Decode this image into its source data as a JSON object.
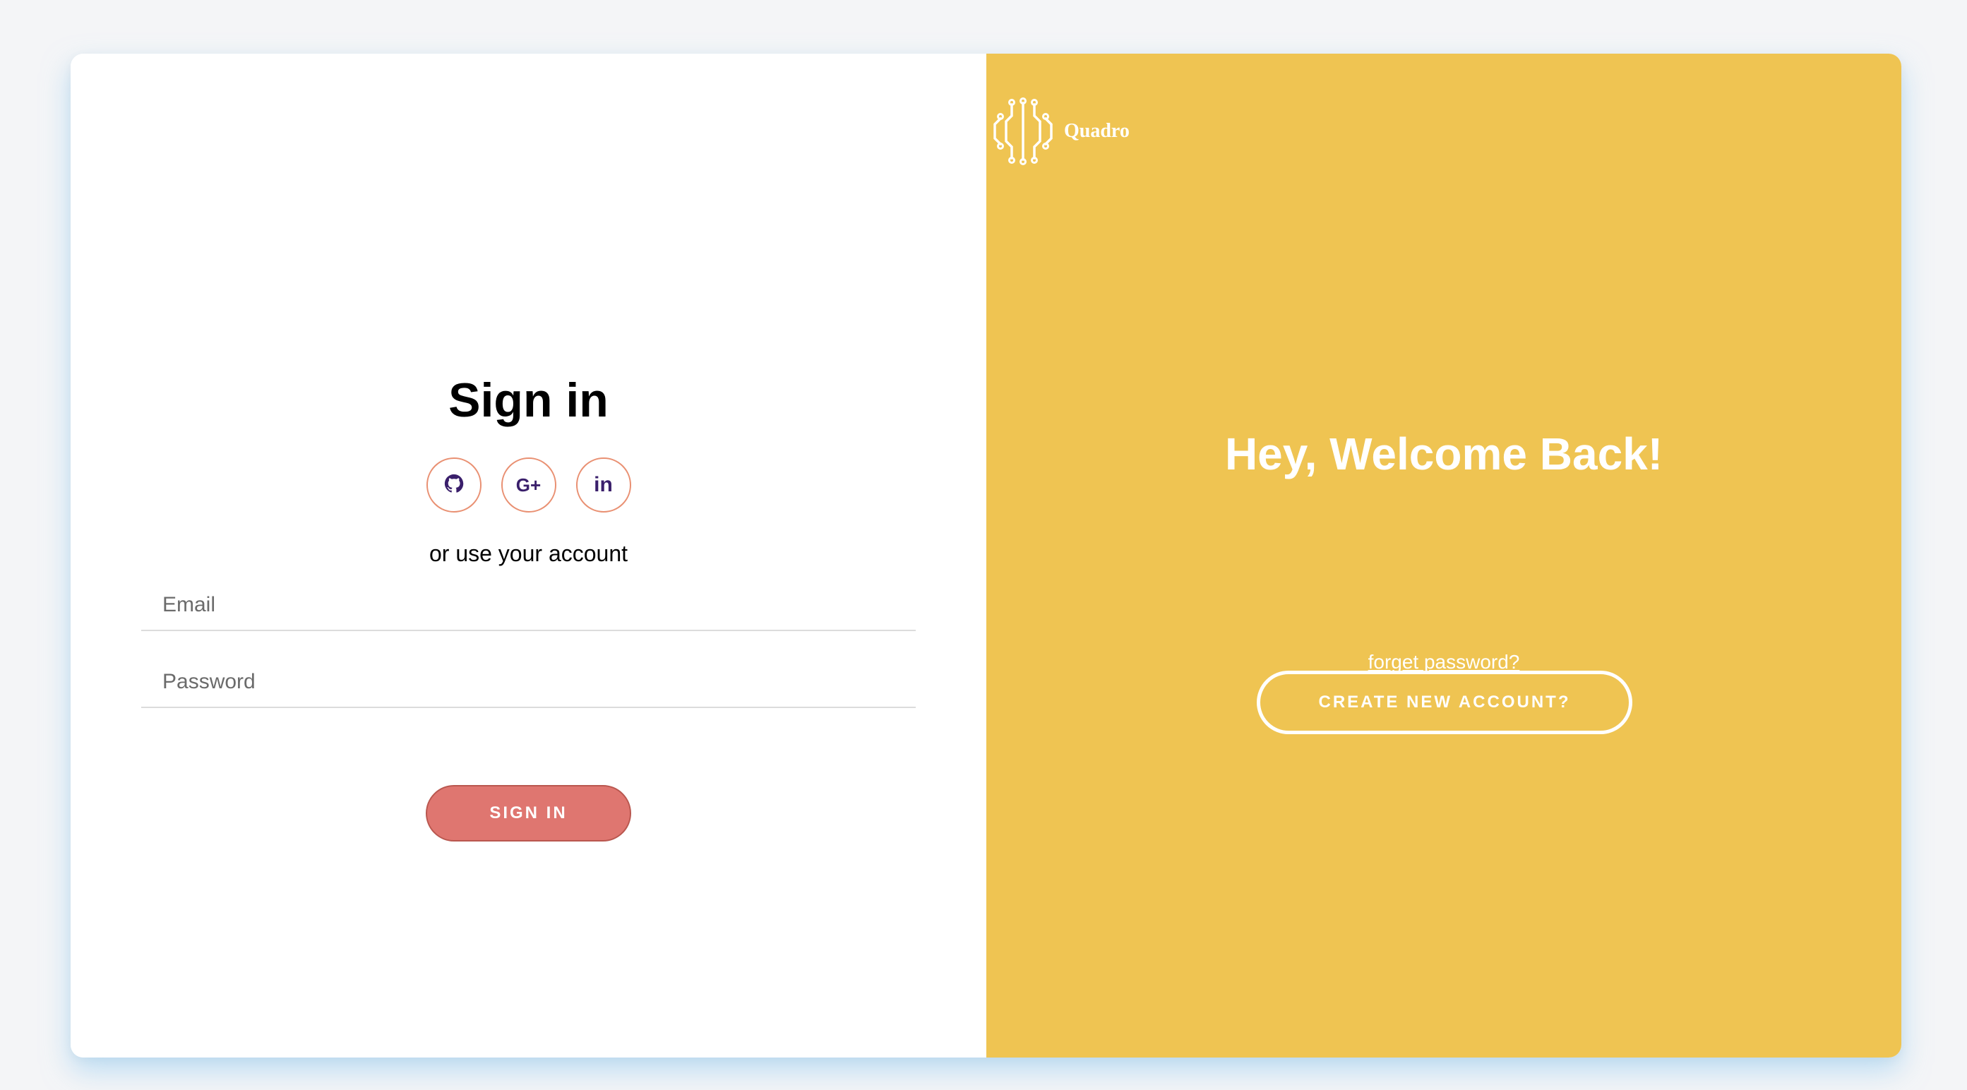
{
  "signin": {
    "title": "Sign in",
    "socials": [
      {
        "icon": "github-icon",
        "label": ""
      },
      {
        "icon": "google-plus-icon",
        "label": "G+"
      },
      {
        "icon": "linkedin-icon",
        "label": "in"
      }
    ],
    "alt_text": "or use your account",
    "email_placeholder": "Email",
    "password_placeholder": "Password",
    "button_label": "SIGN IN"
  },
  "promo": {
    "logo_text": "Quadro",
    "welcome": "Hey, Welcome Back!",
    "forget_link": "forget password?",
    "create_button": "CREATE NEW ACCOUNT?"
  },
  "colors": {
    "page_bg": "#f4f5f7",
    "accent_yellow": "#efc452",
    "signin_button": "#df7670",
    "social_border": "#e99072",
    "social_icon": "#3a1f6b"
  }
}
